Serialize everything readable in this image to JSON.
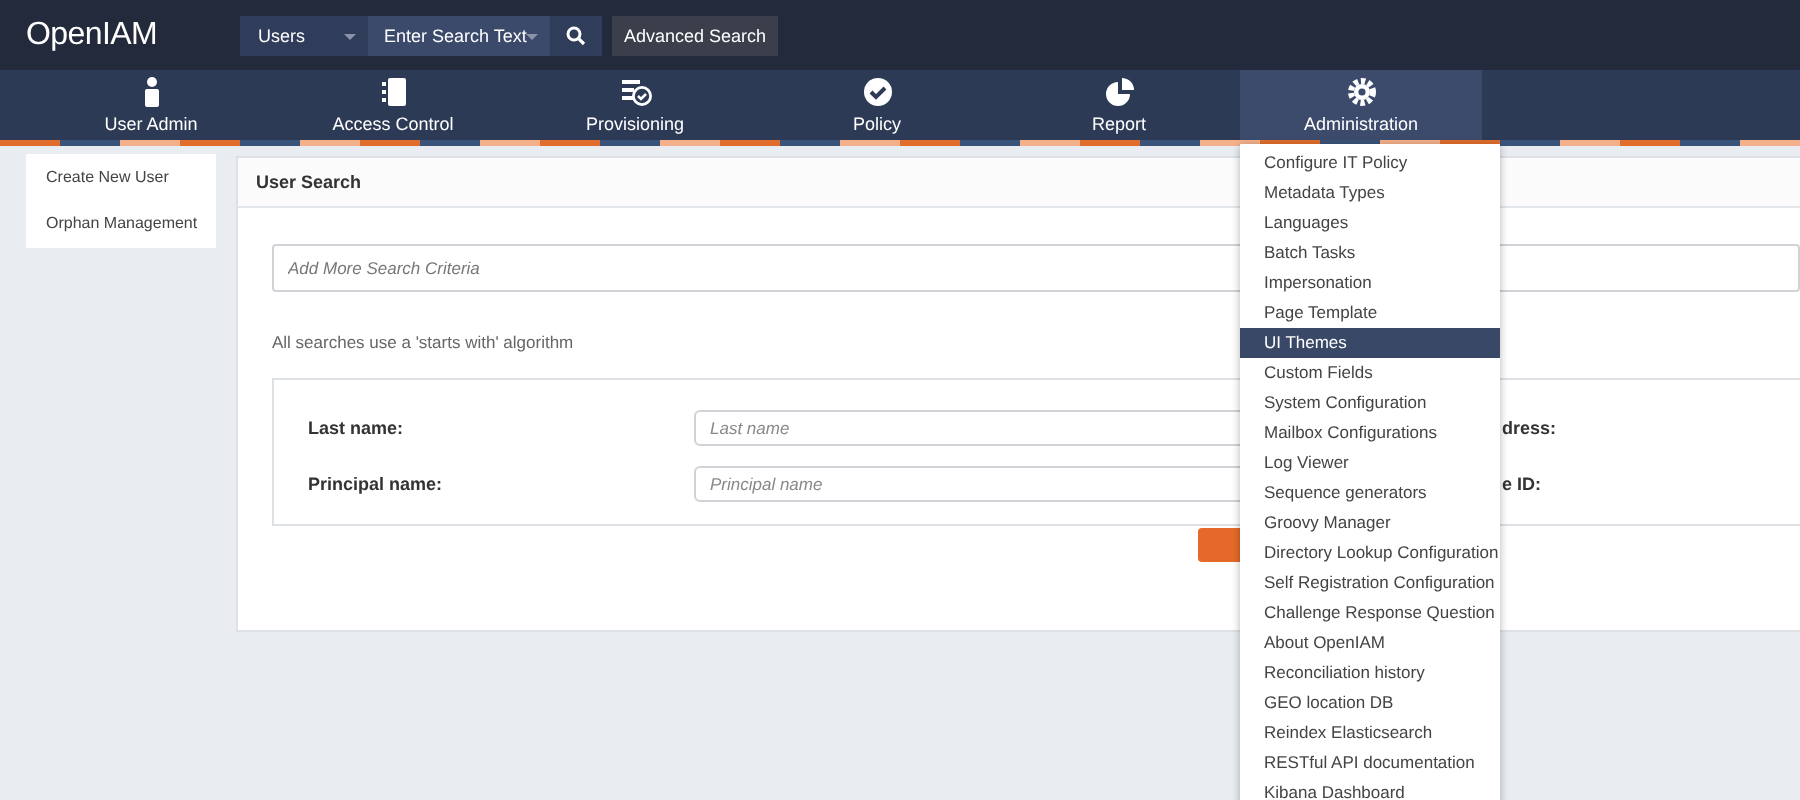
{
  "header": {
    "logo": "OpenIAM",
    "search_type": "Users",
    "search": {
      "placeholder": "Enter Search Text"
    },
    "advanced_button": "Advanced Search"
  },
  "nav_tabs": [
    {
      "label": "User Admin",
      "kind": "user",
      "selected": false
    },
    {
      "label": "Access Control",
      "kind": "book",
      "selected": false
    },
    {
      "label": "Provisioning",
      "kind": "list",
      "selected": false
    },
    {
      "label": "Policy",
      "kind": "check",
      "selected": false
    },
    {
      "label": "Report",
      "kind": "pie",
      "selected": false
    },
    {
      "label": "Administration",
      "kind": "gear",
      "selected": true
    }
  ],
  "sidebar": {
    "items": [
      "Create New User",
      "Orphan Management"
    ]
  },
  "panel": {
    "title": "User Search",
    "criteria": {
      "placeholder": "Add More Search Criteria"
    },
    "note": "All searches use a 'starts with' algorithm",
    "fields": [
      {
        "label": "Last name:",
        "placeholder": "Last name",
        "side_label": "dress:"
      },
      {
        "label": "Principal name:",
        "placeholder": "Principal name",
        "side_label": "e ID:"
      }
    ]
  },
  "dropdown": {
    "items": [
      {
        "label": "Configure IT Policy",
        "selected": false
      },
      {
        "label": "Metadata Types",
        "selected": false
      },
      {
        "label": "Languages",
        "selected": false
      },
      {
        "label": "Batch Tasks",
        "selected": false
      },
      {
        "label": "Impersonation",
        "selected": false
      },
      {
        "label": "Page Template",
        "selected": false
      },
      {
        "label": "UI Themes",
        "selected": true
      },
      {
        "label": "Custom Fields",
        "selected": false
      },
      {
        "label": "System Configuration",
        "selected": false
      },
      {
        "label": "Mailbox Configurations",
        "selected": false
      },
      {
        "label": "Log Viewer",
        "selected": false
      },
      {
        "label": "Sequence generators",
        "selected": false
      },
      {
        "label": "Groovy Manager",
        "selected": false
      },
      {
        "label": "Directory Lookup Configuration",
        "selected": false
      },
      {
        "label": "Self Registration Configuration",
        "selected": false
      },
      {
        "label": "Challenge Response Question",
        "selected": false
      },
      {
        "label": "About OpenIAM",
        "selected": false
      },
      {
        "label": "Reconciliation history",
        "selected": false
      },
      {
        "label": "GEO location DB",
        "selected": false
      },
      {
        "label": "Reindex Elasticsearch",
        "selected": false
      },
      {
        "label": "RESTful API documentation",
        "selected": false
      },
      {
        "label": "Kibana Dashboard",
        "selected": false
      }
    ]
  }
}
